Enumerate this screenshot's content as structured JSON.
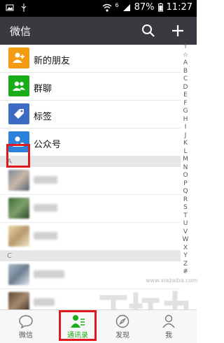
{
  "status_bar": {
    "signal": "6",
    "battery": "87%",
    "time": "11:27"
  },
  "header": {
    "title": "微信",
    "search_icon": "search-icon",
    "add_icon": "plus-icon"
  },
  "functions": [
    {
      "label": "新的朋友",
      "color": "#f39c12",
      "icon": "add-friend-icon"
    },
    {
      "label": "群聊",
      "color": "#1aad19",
      "icon": "group-icon"
    },
    {
      "label": "标签",
      "color": "#3d6bc4",
      "icon": "tag-icon"
    },
    {
      "label": "公众号",
      "color": "#2c82d8",
      "icon": "official-account-icon"
    }
  ],
  "sections": [
    {
      "letter": "A",
      "contacts": 3
    },
    {
      "letter": "C",
      "contacts": 2
    }
  ],
  "index_letters": [
    "↑",
    "☆",
    "A",
    "B",
    "C",
    "D",
    "E",
    "F",
    "G",
    "H",
    "I",
    "J",
    "K",
    "L",
    "M",
    "N",
    "O",
    "P",
    "Q",
    "R",
    "S",
    "T",
    "U",
    "V",
    "W",
    "X",
    "Y",
    "Z",
    "#"
  ],
  "tabs": [
    {
      "label": "微信",
      "icon": "chat-bubble-icon",
      "active": false
    },
    {
      "label": "通讯录",
      "icon": "contacts-icon",
      "active": true
    },
    {
      "label": "发现",
      "icon": "compass-icon",
      "active": false
    },
    {
      "label": "我",
      "icon": "person-icon",
      "active": false
    }
  ],
  "watermark": {
    "text": "下载吧",
    "url": "www.xiazaiba.com"
  },
  "colors": {
    "titlebar": "#393a3f",
    "accent": "#1aad19",
    "highlight": "#e0181f"
  }
}
